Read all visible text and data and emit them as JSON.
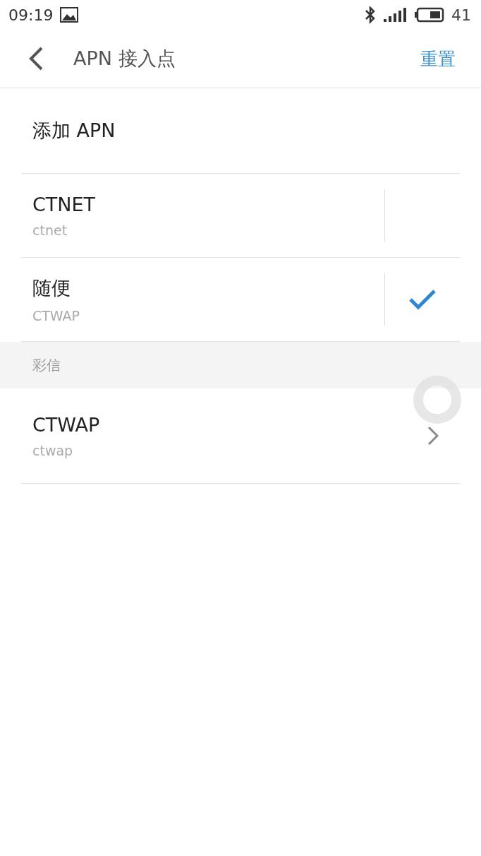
{
  "status_bar": {
    "time": "09:19",
    "battery": "41"
  },
  "header": {
    "title": "APN 接入点",
    "action": "重置"
  },
  "add_item": {
    "label": "添加 APN"
  },
  "apns": [
    {
      "name": "CTNET",
      "apn": "ctnet",
      "selected": false
    },
    {
      "name": "随便",
      "apn": "CTWAP",
      "selected": true
    }
  ],
  "mms_section": {
    "title": "彩信",
    "items": [
      {
        "name": "CTWAP",
        "apn": "ctwap"
      }
    ]
  }
}
